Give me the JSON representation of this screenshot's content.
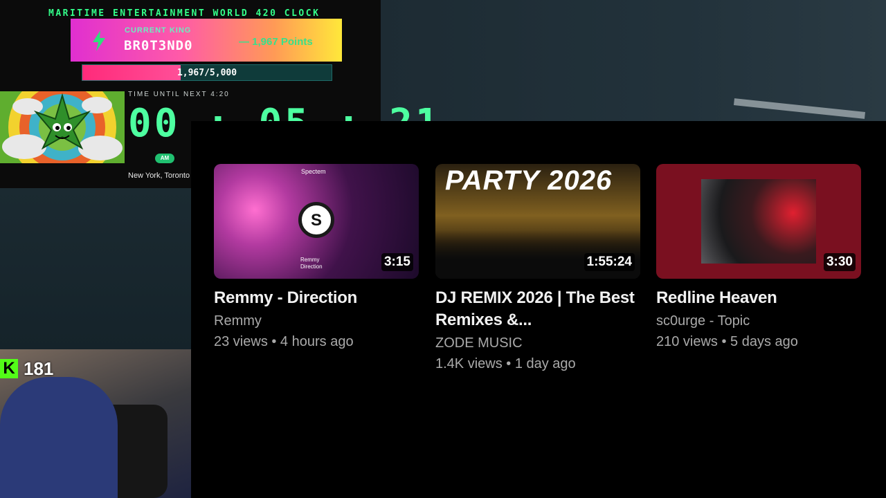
{
  "clock": {
    "header": "MARITIME ENTERTAINMENT WORLD 420 CLOCK",
    "king_label": "CURRENT KING",
    "king_name": "BR0T3ND0",
    "king_points": "— 1,967 Points",
    "progress_text": "1,967/5,000",
    "progress_value": 0.3934,
    "time_label": "TIME UNTIL NEXT 4:20",
    "countdown": "00 : 05 : 21",
    "ampm": "AM",
    "city": "New York, Toronto"
  },
  "videos": [
    {
      "title": "Remmy - Direction",
      "channel": "Remmy",
      "meta": "23 views • 4 hours ago",
      "duration": "3:15",
      "thumb_brand": "Spectem",
      "thumb_caption": "Remmy",
      "thumb_caption_sub": "Direction"
    },
    {
      "title": "DJ REMIX 2026 | The Best Remixes &...",
      "channel": "ZODE MUSIC",
      "meta": "1.4K views • 1 day ago",
      "duration": "1:55:24",
      "thumb_text": "PARTY 2026"
    },
    {
      "title": "Redline Heaven",
      "channel": "sc0urge - Topic",
      "meta": "210 views • 5 days ago",
      "duration": "3:30"
    }
  ],
  "stream": {
    "kick_icon": "K",
    "viewer_count": "181"
  },
  "colors": {
    "clock_green": "#4dffa0",
    "kick_green": "#53fc18",
    "progress_pink": "#ff2a7a"
  }
}
